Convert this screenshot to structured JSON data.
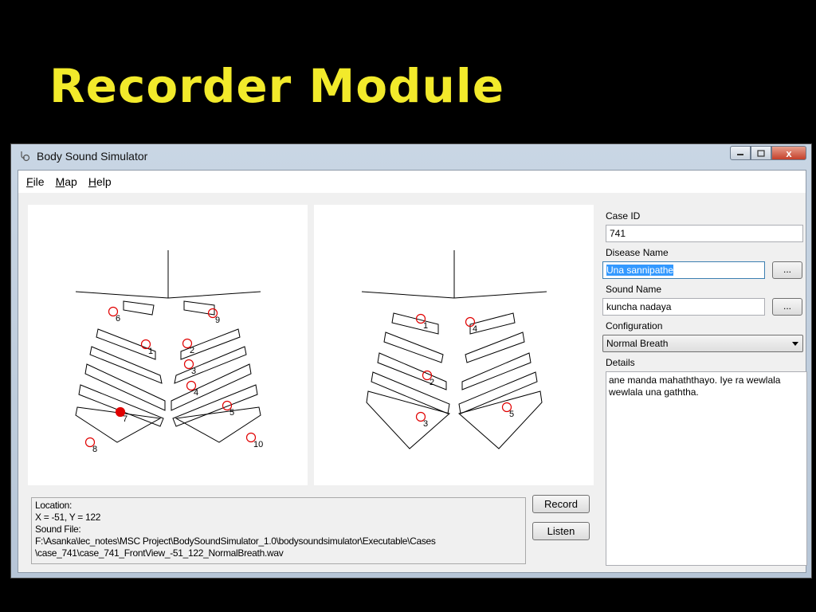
{
  "slide": {
    "title": "Recorder Module"
  },
  "window": {
    "title": "Body Sound Simulator",
    "icon": "stethoscope-icon",
    "controls": {
      "minimize_icon": "minimize-icon",
      "maximize_icon": "maximize-icon",
      "close_icon": "close-icon",
      "close_label": "x"
    }
  },
  "menu": [
    "File",
    "Map",
    "Help"
  ],
  "front_view": {
    "points": [
      {
        "label": "1",
        "filled": false
      },
      {
        "label": "2",
        "filled": false
      },
      {
        "label": "3",
        "filled": false
      },
      {
        "label": "4",
        "filled": false
      },
      {
        "label": "5",
        "filled": false
      },
      {
        "label": "6",
        "filled": false
      },
      {
        "label": "7",
        "filled": true
      },
      {
        "label": "8",
        "filled": false
      },
      {
        "label": "9",
        "filled": false
      },
      {
        "label": "10",
        "filled": false
      }
    ]
  },
  "back_view": {
    "points": [
      {
        "label": "1",
        "filled": false
      },
      {
        "label": "4",
        "filled": false
      },
      {
        "label": "2",
        "filled": false
      },
      {
        "label": "3",
        "filled": false
      },
      {
        "label": "5",
        "filled": false
      }
    ]
  },
  "status": {
    "location_label": "Location:",
    "coords": "X = -51, Y = 122",
    "sound_file_label": "Sound File:",
    "path_line1": "F:\\Asanka\\lec_notes\\MSC Project\\BodySoundSimulator_1.0\\bodysoundsimulator\\Executable\\Cases",
    "path_line2": "\\case_741\\case_741_FrontView_-51_122_NormalBreath.wav"
  },
  "buttons": {
    "record": "Record",
    "listen": "Listen",
    "browse": "..."
  },
  "form": {
    "case_id_label": "Case ID",
    "case_id": "741",
    "disease_name_label": "Disease Name",
    "disease_name": "Una sannipathe",
    "sound_name_label": "Sound Name",
    "sound_name": "kuncha nadaya",
    "configuration_label": "Configuration",
    "configuration": "Normal Breath",
    "details_label": "Details",
    "details": "ane manda mahaththayo. Iye ra wewlala wewlala una gaththa."
  }
}
